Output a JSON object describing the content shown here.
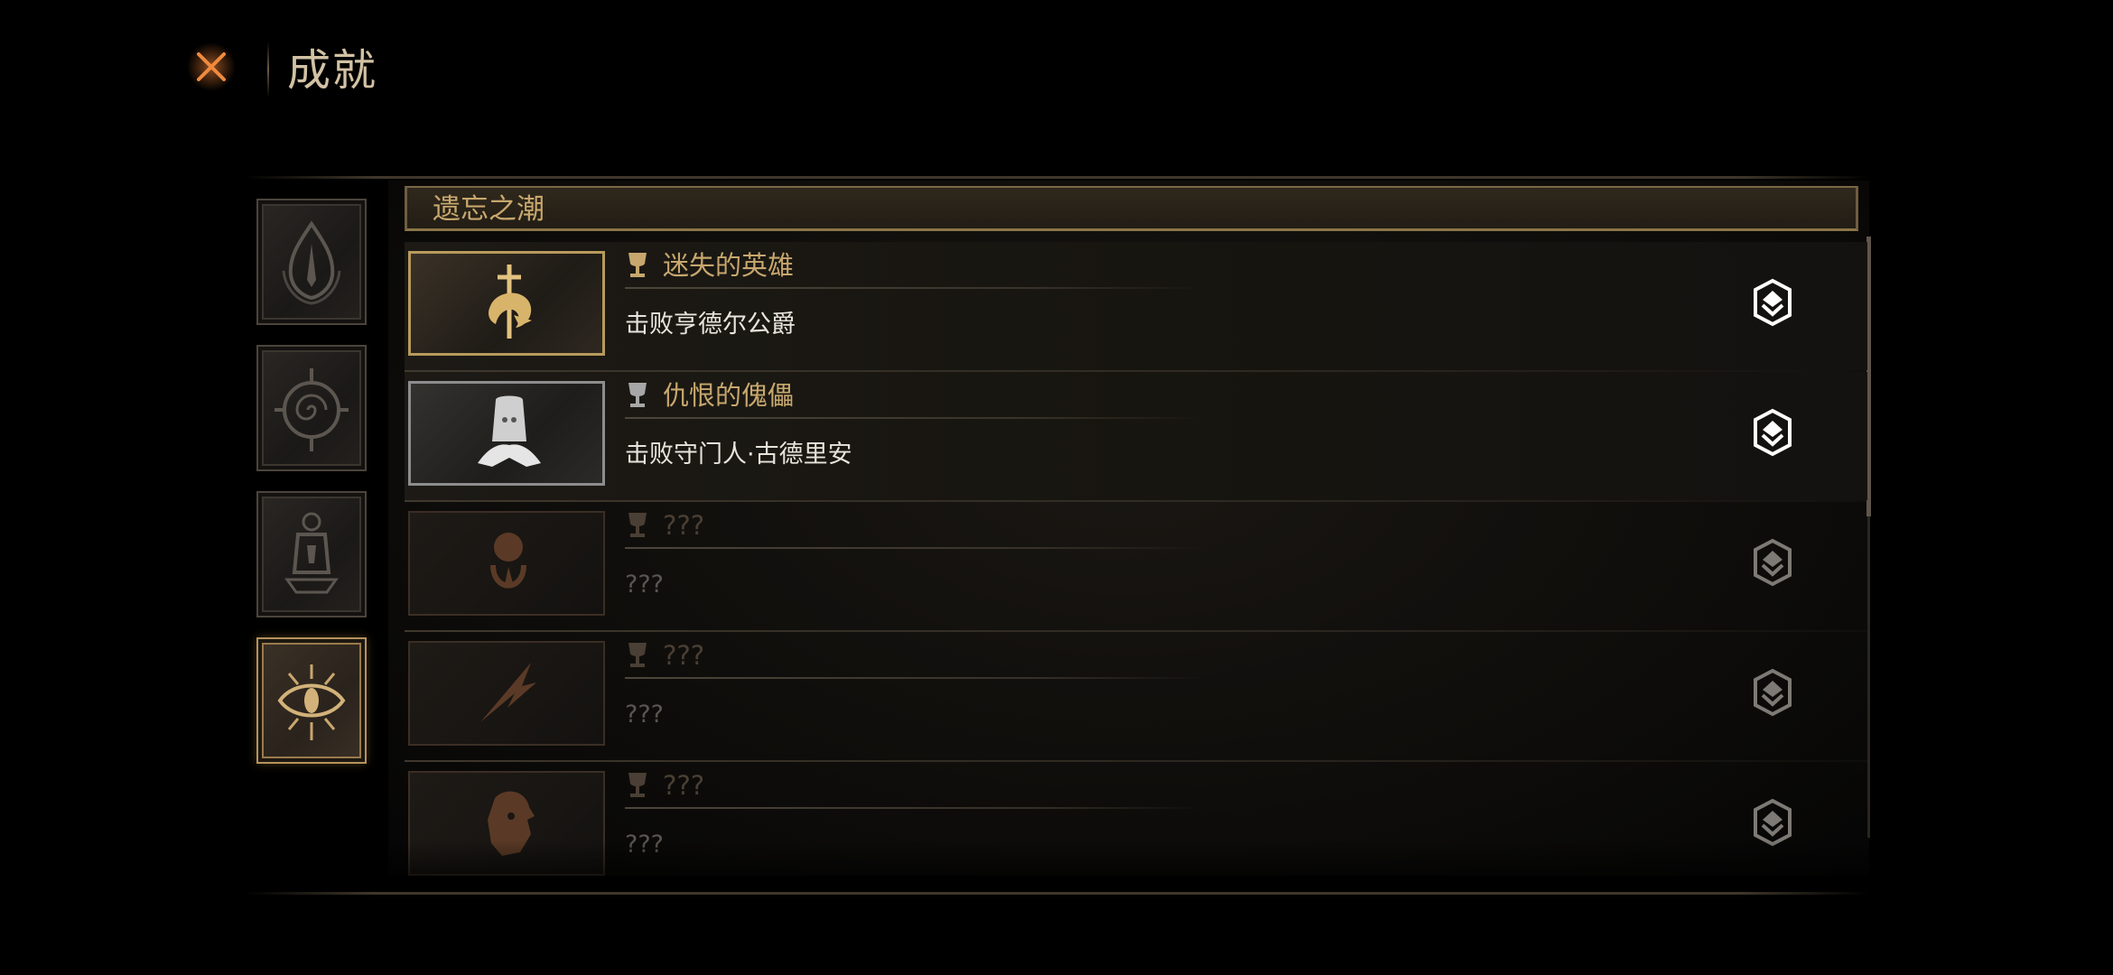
{
  "header": {
    "title": "成就",
    "close_icon": "close-x-icon"
  },
  "sidebar": {
    "tabs": [
      {
        "icon": "flame-crest-icon",
        "active": false
      },
      {
        "icon": "spiral-sun-icon",
        "active": false
      },
      {
        "icon": "lantern-relic-icon",
        "active": false
      },
      {
        "icon": "eye-sigil-icon",
        "active": true
      }
    ]
  },
  "section": {
    "title": "遗忘之潮"
  },
  "achievements": [
    {
      "title": "迷失的英雄",
      "description": "击败亨德尔公爵",
      "badge": "gold",
      "art_icon": "sword-beast-icon",
      "status_icon": "rank-emblem-icon",
      "locked": false
    },
    {
      "title": "仇恨的傀儡",
      "description": "击败守门人·古德里安",
      "badge": "silver",
      "art_icon": "bell-golem-icon",
      "status_icon": "rank-emblem-icon",
      "locked": false
    },
    {
      "title": "???",
      "description": "???",
      "badge": "locked",
      "art_icon": "root-seed-icon",
      "status_icon": "rank-emblem-icon",
      "locked": true
    },
    {
      "title": "???",
      "description": "???",
      "badge": "locked",
      "art_icon": "feather-blade-icon",
      "status_icon": "rank-emblem-icon",
      "locked": true
    },
    {
      "title": "???",
      "description": "???",
      "badge": "locked",
      "art_icon": "lion-head-icon",
      "status_icon": "rank-emblem-icon",
      "locked": true
    }
  ],
  "colors": {
    "accent_gold": "#c7a76d",
    "close_orange": "#e8773a",
    "locked_text": "#4a3f34"
  }
}
